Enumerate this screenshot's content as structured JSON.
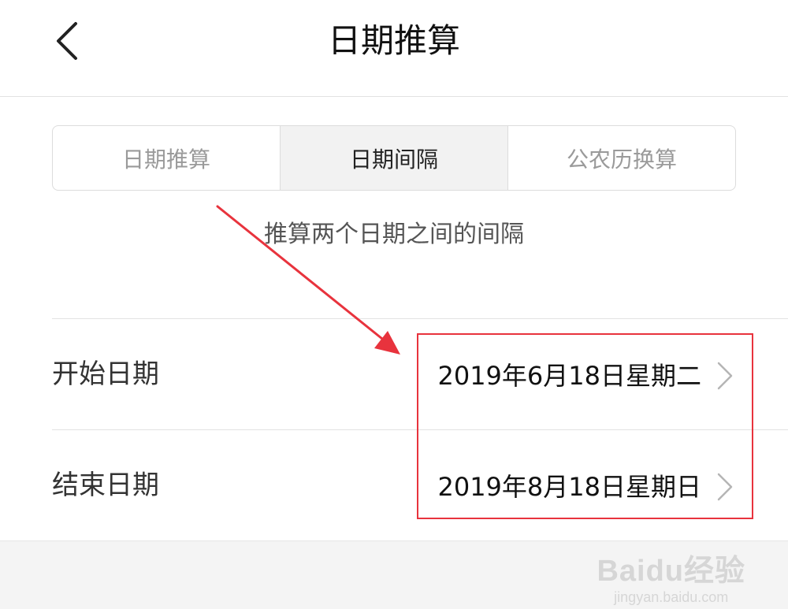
{
  "header": {
    "title": "日期推算",
    "back_icon": "chevron-left-icon"
  },
  "tabs": [
    {
      "label": "日期推算",
      "active": false
    },
    {
      "label": "日期间隔",
      "active": true
    },
    {
      "label": "公农历换算",
      "active": false
    }
  ],
  "description": "推算两个日期之间的间隔",
  "start_row": {
    "label": "开始日期",
    "value": "2019年6月18日星期二",
    "icon": "chevron-right-icon"
  },
  "end_row": {
    "label": "结束日期",
    "value": "2019年8月18日星期日",
    "icon": "chevron-right-icon"
  },
  "annotation": {
    "color": "#e8333d"
  },
  "watermark": {
    "logo_text": "Baidu经验",
    "url": "jingyan.baidu.com"
  }
}
